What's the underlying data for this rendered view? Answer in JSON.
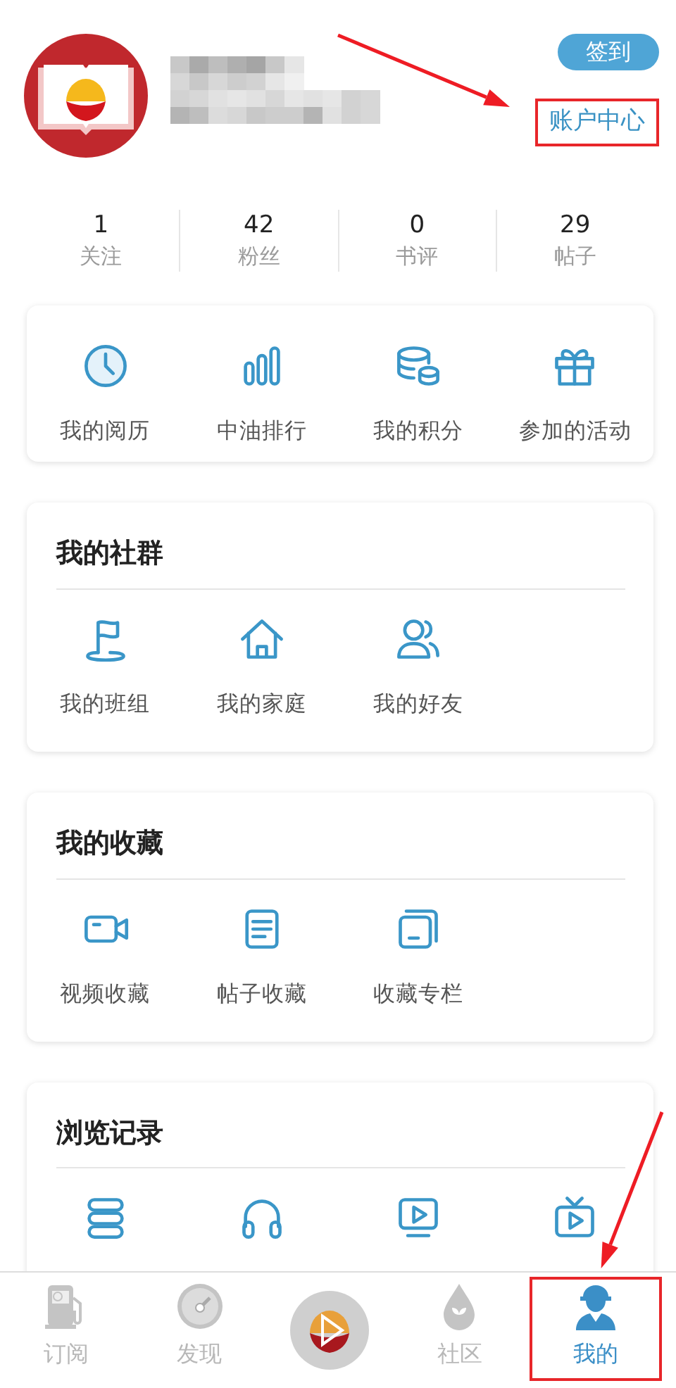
{
  "profile": {
    "sign_in": "签到",
    "account_center": {
      "label": "账户中心",
      "highlighted": true
    }
  },
  "stats": [
    {
      "value": "1",
      "label": "关注"
    },
    {
      "value": "42",
      "label": "粉丝"
    },
    {
      "value": "0",
      "label": "书评"
    },
    {
      "value": "29",
      "label": "帖子"
    }
  ],
  "shortcuts": [
    {
      "label": "我的阅历"
    },
    {
      "label": "中油排行"
    },
    {
      "label": "我的积分"
    },
    {
      "label": "参加的活动"
    }
  ],
  "sections": [
    {
      "title": "我的社群",
      "items": [
        {
          "label": "我的班组"
        },
        {
          "label": "我的家庭"
        },
        {
          "label": "我的好友"
        }
      ]
    },
    {
      "title": "我的收藏",
      "items": [
        {
          "label": "视频收藏"
        },
        {
          "label": "帖子收藏"
        },
        {
          "label": "收藏专栏"
        }
      ]
    },
    {
      "title": "浏览记录"
    }
  ],
  "tabs": [
    {
      "label": "订阅",
      "selected": false,
      "highlighted": false
    },
    {
      "label": "发现",
      "selected": false,
      "highlighted": false
    },
    {
      "label": "社区",
      "selected": false,
      "highlighted": false
    },
    {
      "label": "我的",
      "selected": true,
      "highlighted": true
    }
  ]
}
